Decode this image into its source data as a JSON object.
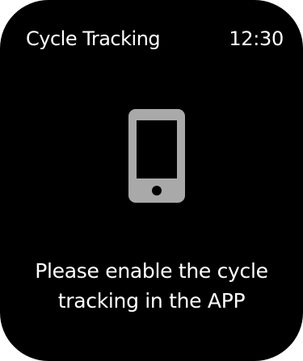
{
  "header": {
    "title": "Cycle Tracking",
    "time": "12:30"
  },
  "main": {
    "icon": "smartphone-icon",
    "message": "Please enable the cycle tracking in the APP"
  },
  "colors": {
    "background": "#000000",
    "text": "#ffffff",
    "icon": "#a9a9a9"
  }
}
